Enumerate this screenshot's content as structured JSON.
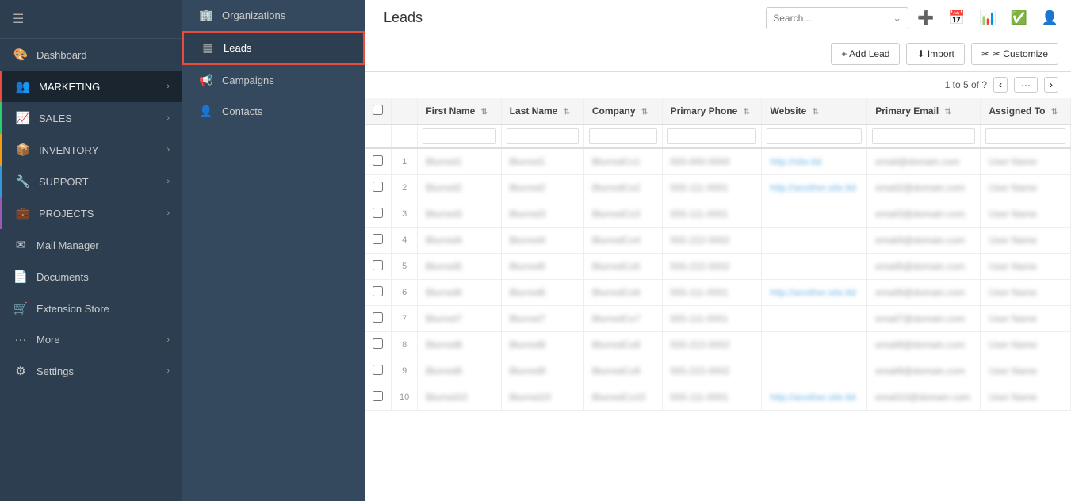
{
  "sidebar": {
    "hamburger": "☰",
    "items": [
      {
        "id": "dashboard",
        "label": "Dashboard",
        "icon": "🎨",
        "colorBar": ""
      },
      {
        "id": "marketing",
        "label": "MARKETING",
        "icon": "👥",
        "colorBar": "",
        "active": true,
        "hasChevron": true
      },
      {
        "id": "sales",
        "label": "SALES",
        "icon": "📈",
        "colorBar": "green",
        "hasChevron": true
      },
      {
        "id": "inventory",
        "label": "INVENTORY",
        "icon": "📦",
        "colorBar": "yellow",
        "hasChevron": true
      },
      {
        "id": "support",
        "label": "SUPPORT",
        "icon": "🔧",
        "colorBar": "blue",
        "hasChevron": true
      },
      {
        "id": "projects",
        "label": "PROJECTS",
        "icon": "💼",
        "colorBar": "purple",
        "hasChevron": true
      },
      {
        "id": "mail-manager",
        "label": "Mail Manager",
        "icon": "✉️",
        "colorBar": ""
      },
      {
        "id": "documents",
        "label": "Documents",
        "icon": "📄",
        "colorBar": ""
      },
      {
        "id": "extension-store",
        "label": "Extension Store",
        "icon": "🛒",
        "colorBar": ""
      },
      {
        "id": "more",
        "label": "More",
        "icon": "···",
        "colorBar": "",
        "hasChevron": true
      },
      {
        "id": "settings",
        "label": "Settings",
        "icon": "⚙️",
        "colorBar": "",
        "hasChevron": true
      }
    ]
  },
  "submenu": {
    "items": [
      {
        "id": "organizations",
        "label": "Organizations",
        "icon": "🏢"
      },
      {
        "id": "leads",
        "label": "Leads",
        "icon": "▦",
        "highlighted": true
      },
      {
        "id": "campaigns",
        "label": "Campaigns",
        "icon": "📢"
      },
      {
        "id": "contacts",
        "label": "Contacts",
        "icon": "👤"
      }
    ]
  },
  "topbar": {
    "title": "Leads",
    "search_placeholder": "Search...",
    "icons": [
      "➕",
      "📅",
      "📊",
      "✅",
      "👤"
    ]
  },
  "actionbar": {
    "add_lead": "+ Add Lead",
    "import": "⬇ Import",
    "customize": "✂ Customize"
  },
  "pagination": {
    "info": "1 to 5 of ?",
    "prev": "‹",
    "next": "›",
    "dots": "···"
  },
  "table": {
    "columns": [
      {
        "id": "checkbox",
        "label": ""
      },
      {
        "id": "num",
        "label": ""
      },
      {
        "id": "first_name",
        "label": "First Name"
      },
      {
        "id": "last_name",
        "label": "Last Name"
      },
      {
        "id": "company",
        "label": "Company"
      },
      {
        "id": "primary_phone",
        "label": "Primary Phone"
      },
      {
        "id": "website",
        "label": "Website"
      },
      {
        "id": "primary_email",
        "label": "Primary Email"
      },
      {
        "id": "assigned_to",
        "label": "Assigned To"
      }
    ],
    "rows": [
      {
        "first_name": "Blurred1",
        "last_name": "Blurred1",
        "company": "BlurredCo1",
        "primary_phone": "555-000-0000",
        "website": "http://site.tld",
        "primary_email": "email@domain.com",
        "assigned_to": "User Name"
      },
      {
        "first_name": "Blurred2",
        "last_name": "Blurred2",
        "company": "BlurredCo2",
        "primary_phone": "555-111-0001",
        "website": "http://another.site.tld",
        "primary_email": "email2@domain.com",
        "assigned_to": "User Name"
      },
      {
        "first_name": "Blurred3",
        "last_name": "Blurred3",
        "company": "BlurredCo3",
        "primary_phone": "555-111-0001",
        "website": "",
        "primary_email": "email3@domain.com",
        "assigned_to": "User Name"
      },
      {
        "first_name": "Blurred4",
        "last_name": "Blurred4",
        "company": "BlurredCo4",
        "primary_phone": "555-222-0002",
        "website": "",
        "primary_email": "email4@domain.com",
        "assigned_to": "User Name"
      },
      {
        "first_name": "Blurred5",
        "last_name": "Blurred5",
        "company": "BlurredCo5",
        "primary_phone": "555-222-0002",
        "website": "",
        "primary_email": "email5@domain.com",
        "assigned_to": "User Name"
      },
      {
        "first_name": "Blurred6",
        "last_name": "Blurred6",
        "company": "BlurredCo6",
        "primary_phone": "555-111-0001",
        "website": "http://another.site.tld",
        "primary_email": "email6@domain.com",
        "assigned_to": "User Name"
      },
      {
        "first_name": "Blurred7",
        "last_name": "Blurred7",
        "company": "BlurredCo7",
        "primary_phone": "555-111-0001",
        "website": "",
        "primary_email": "email7@domain.com",
        "assigned_to": "User Name"
      },
      {
        "first_name": "Blurred8",
        "last_name": "Blurred8",
        "company": "BlurredCo8",
        "primary_phone": "555-222-0002",
        "website": "",
        "primary_email": "email8@domain.com",
        "assigned_to": "User Name"
      },
      {
        "first_name": "Blurred9",
        "last_name": "Blurred9",
        "company": "BlurredCo9",
        "primary_phone": "555-222-0002",
        "website": "",
        "primary_email": "email9@domain.com",
        "assigned_to": "User Name"
      },
      {
        "first_name": "Blurred10",
        "last_name": "Blurred10",
        "company": "BlurredCo10",
        "primary_phone": "555-111-0001",
        "website": "http://another.site.tld",
        "primary_email": "email10@domain.com",
        "assigned_to": "User Name"
      }
    ]
  },
  "colors": {
    "sidebar_bg": "#2c3e50",
    "sidebar_active": "#1a252f",
    "submenu_bg": "#34495e",
    "accent_red": "#e74c3c",
    "link_blue": "#3498db"
  }
}
